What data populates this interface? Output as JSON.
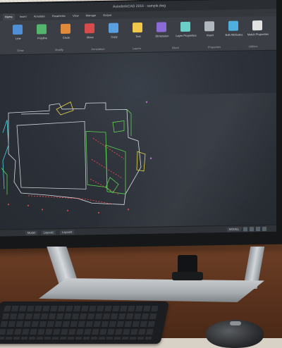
{
  "window": {
    "title": "AutodeskCAD 2016 - sample.dwg"
  },
  "tabs": [
    {
      "label": "Home",
      "active": true
    },
    {
      "label": "Insert",
      "active": false
    },
    {
      "label": "Annotate",
      "active": false
    },
    {
      "label": "Parametric",
      "active": false
    },
    {
      "label": "View",
      "active": false
    },
    {
      "label": "Manage",
      "active": false
    },
    {
      "label": "Output",
      "active": false
    }
  ],
  "ribbon": {
    "panels": [
      "Draw",
      "Modify",
      "Annotation",
      "Layers",
      "Block",
      "Properties",
      "Utilities"
    ],
    "buttons": [
      {
        "label": "Line",
        "color": "#4f8fd6"
      },
      {
        "label": "Polyline",
        "color": "#53b66c"
      },
      {
        "label": "Circle",
        "color": "#e08a3a"
      },
      {
        "label": "Move",
        "color": "#d84b4b"
      },
      {
        "label": "Copy",
        "color": "#5aa0e0"
      },
      {
        "label": "Text",
        "color": "#f0c84a"
      },
      {
        "label": "Dimension",
        "color": "#8b6cd6"
      },
      {
        "label": "Layer Properties",
        "color": "#6ad0c7"
      },
      {
        "label": "Insert",
        "color": "#b0b7bf"
      },
      {
        "label": "Edit Attributes",
        "color": "#4fb0e0"
      },
      {
        "label": "Match Properties",
        "color": "#e2e2e2"
      }
    ]
  },
  "statusbar": {
    "tabs": [
      "Model",
      "Layout1",
      "Layout2"
    ],
    "model_label": "MODEL"
  },
  "colors": {
    "canvas": "#2e333b",
    "drawing_green": "#5bd34f",
    "drawing_red": "#ff4a4a",
    "drawing_yellow": "#e6d84a",
    "drawing_cyan": "#4ad4e6",
    "drawing_white": "#d8dde2"
  }
}
